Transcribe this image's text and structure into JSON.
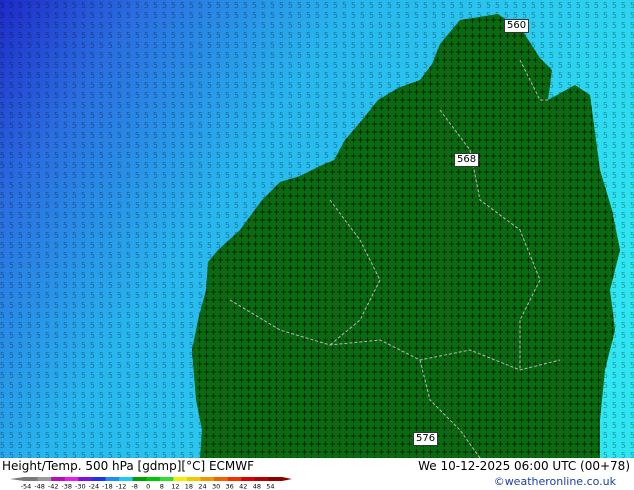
{
  "map": {
    "ocean_colors": [
      "#1e2ac8",
      "#2a6de0",
      "#27b6ee",
      "#2fe6f2"
    ],
    "land_color": "#0a6a10",
    "wind_barb_color": "#000000",
    "border_color": "#b8b8b8",
    "contour_labels": [
      "560",
      "568",
      "576"
    ]
  },
  "footer": {
    "title_left": "Height/Temp. 500 hPa [gdmp][°C] ECMWF",
    "title_right": "We 10-12-2025 06:00 UTC (00+78)",
    "credit": "©weatheronline.co.uk"
  },
  "colorbar": {
    "ticks": [
      "-54",
      "-48",
      "-42",
      "-38",
      "-30",
      "-24",
      "-18",
      "-12",
      "-8",
      "0",
      "8",
      "12",
      "18",
      "24",
      "30",
      "36",
      "42",
      "48",
      "54"
    ],
    "colors": [
      "#7a7a7a",
      "#9b9b9b",
      "#b40fb4",
      "#e61ee6",
      "#7814dc",
      "#1e32f0",
      "#1e8cf0",
      "#1ec8f0",
      "#00a000",
      "#00c800",
      "#32dc32",
      "#f0f000",
      "#f0c800",
      "#f09600",
      "#f06400",
      "#f03200",
      "#dc0000",
      "#b40000",
      "#8c0000"
    ]
  }
}
